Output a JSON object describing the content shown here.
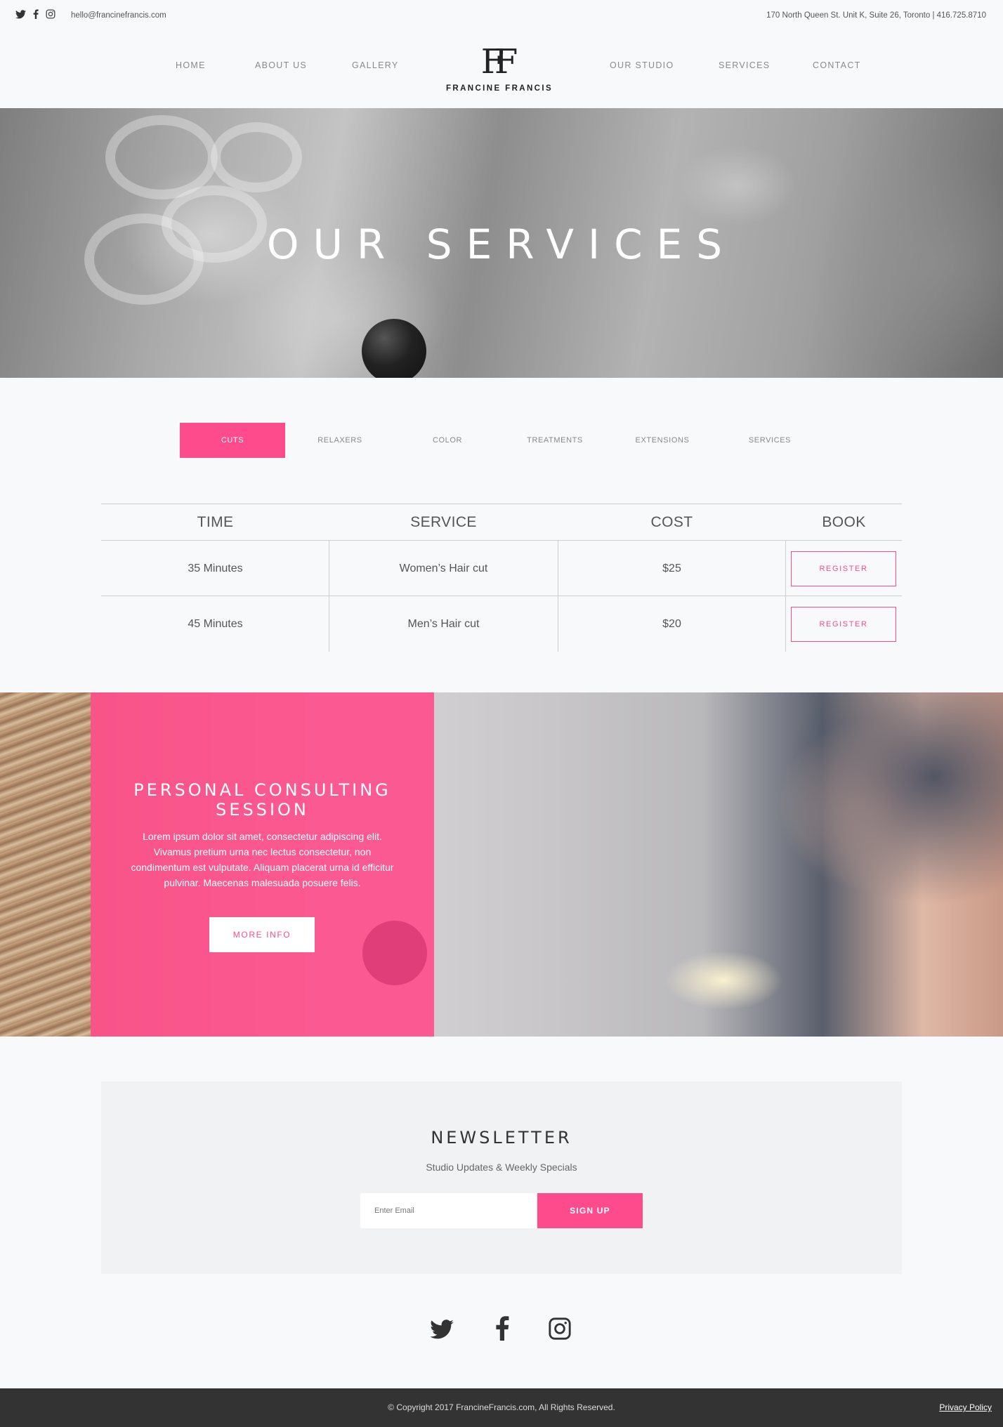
{
  "topbar": {
    "email": "hello@francinefrancis.com",
    "address": "170 North Queen St. Unit K, Suite 26, Toronto | 416.725.8710",
    "social": [
      "twitter-icon",
      "facebook-icon",
      "instagram-icon"
    ]
  },
  "nav": {
    "left": [
      "HOME",
      "ABOUT US",
      "GALLERY"
    ],
    "right": [
      "OUR STUDIO",
      "SERVICES",
      "CONTACT"
    ],
    "logo_mark": "FF",
    "logo_name": "FRANCINE FRANCIS"
  },
  "hero": {
    "title": "OUR SERVICES"
  },
  "tabs": [
    "CUTS",
    "RELAXERS",
    "COLOR",
    "TREATMENTS",
    "EXTENSIONS",
    "SERVICES"
  ],
  "table": {
    "headers": [
      "TIME",
      "SERVICE",
      "COST",
      "BOOK"
    ],
    "rows": [
      {
        "time": "35 Minutes",
        "service": "Women’s Hair cut",
        "cost": "$25",
        "book": "REGISTER"
      },
      {
        "time": "45 Minutes",
        "service": "Men’s Hair cut",
        "cost": "$20",
        "book": "REGISTER"
      }
    ]
  },
  "promo": {
    "title": "PERSONAL CONSULTING SESSION",
    "body": "Lorem ipsum dolor sit amet, consectetur adipiscing elit. Vivamus pretium urna nec lectus consectetur, non condimentum est vulputate. Aliquam placerat urna id efficitur pulvinar. Maecenas malesuada posuere felis.",
    "button": "MORE INFO"
  },
  "newsletter": {
    "title": "NEWSLETTER",
    "subtitle": "Studio Updates & Weekly Specials",
    "placeholder": "Enter Email",
    "button": "SIGN UP"
  },
  "footer": {
    "copyright": "© Copyright 2017 FrancineFrancis.com, All Rights Reserved.",
    "policy": "Privacy Policy"
  },
  "colors": {
    "accent": "#fe4b8c",
    "footer_bg": "#333333",
    "page_bg": "#f8f9fb"
  }
}
